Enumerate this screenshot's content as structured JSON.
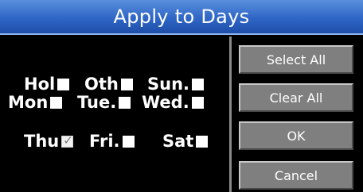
{
  "dialog": {
    "title": "Apply to Days"
  },
  "days": [
    {
      "label": "Hol",
      "checked": false
    },
    {
      "label": "Oth",
      "checked": false
    },
    {
      "label": "Sun.",
      "checked": false
    },
    {
      "label": "Mon",
      "checked": false
    },
    {
      "label": "Tue.",
      "checked": false
    },
    {
      "label": "Wed.",
      "checked": false
    },
    {
      "label": "Thu",
      "checked": true
    },
    {
      "label": "Fri.",
      "checked": false
    },
    {
      "label": "Sat",
      "checked": false
    }
  ],
  "buttons": {
    "select_all": "Select All",
    "clear_all": "Clear All",
    "ok": "OK",
    "cancel": "Cancel"
  },
  "colors": {
    "title_bar": "#2f66c6",
    "background": "#000000",
    "button_face": "#7f7f7f",
    "text": "#ffffff"
  }
}
